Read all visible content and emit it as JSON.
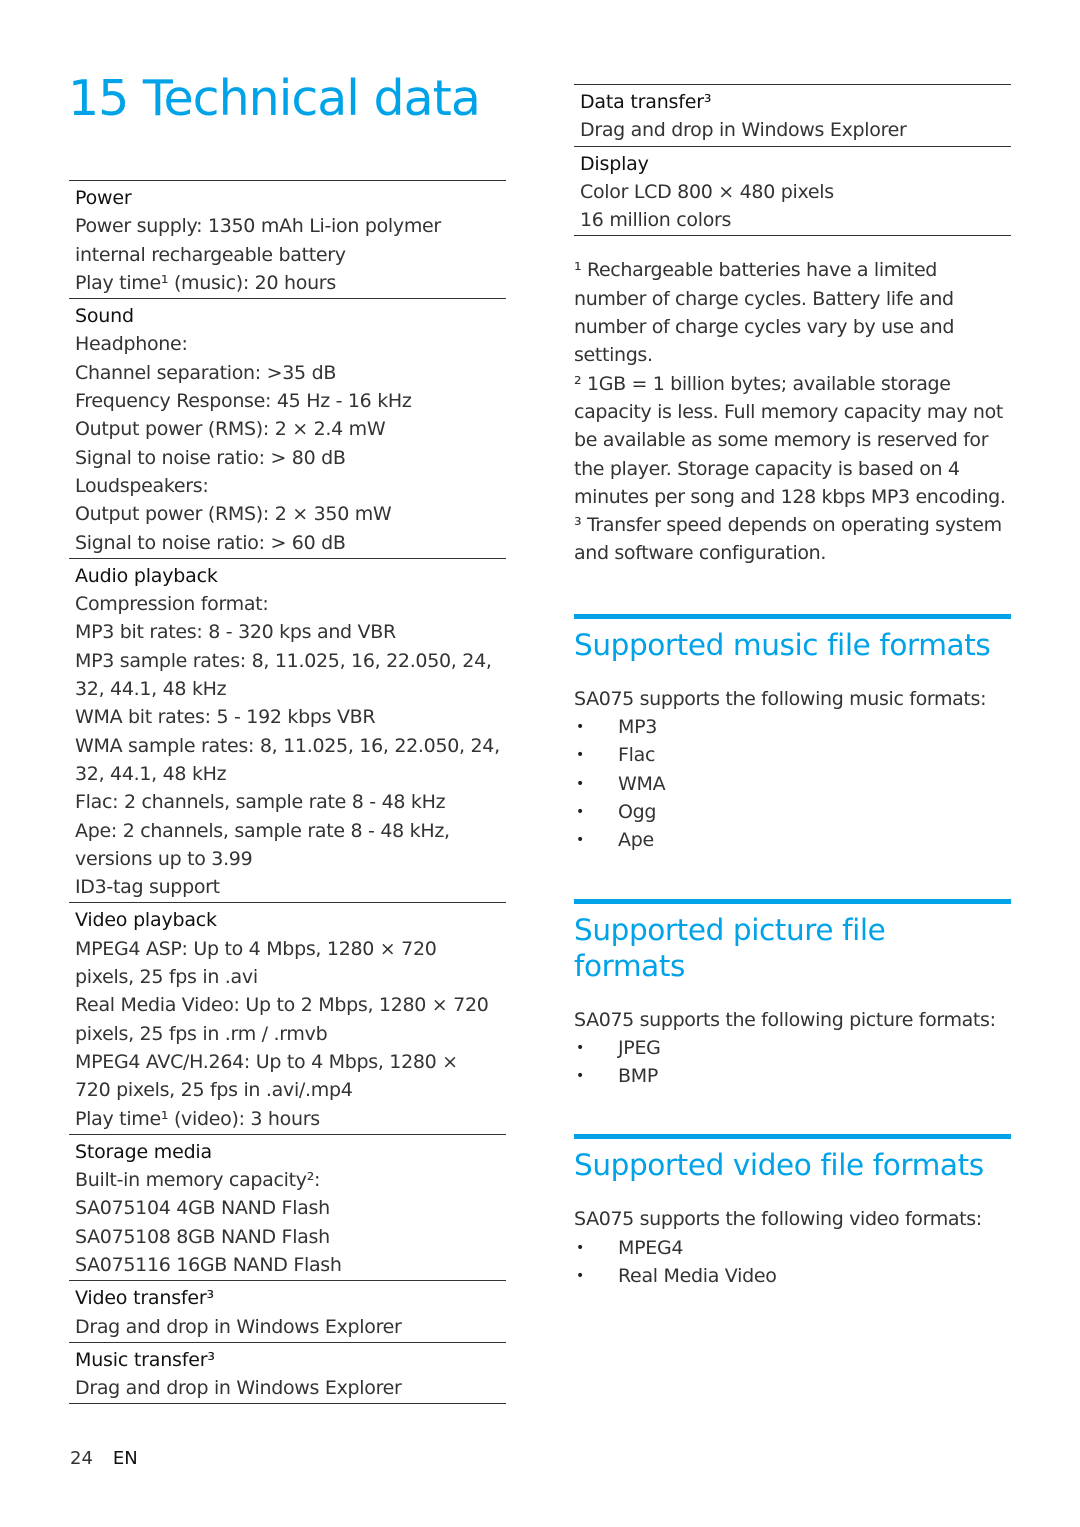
{
  "page": {
    "title": "15 Technical data",
    "accent_color": "#00a3e8"
  },
  "specs": [
    {
      "heading": "Power",
      "lines": [
        "Power supply: 1350 mAh Li-ion polymer",
        "internal rechargeable battery",
        "Play time¹ (music): 20 hours"
      ]
    },
    {
      "heading": "Sound",
      "lines": [
        "Headphone:",
        "Channel separation: >35 dB",
        "Frequency Response: 45 Hz - 16 kHz",
        "Output power (RMS): 2 × 2.4 mW",
        "Signal to noise ratio: > 80 dB",
        "Loudspeakers:",
        "Output power (RMS): 2 × 350 mW",
        "Signal to noise ratio: > 60 dB"
      ]
    },
    {
      "heading": "Audio playback",
      "lines": [
        "Compression format:",
        "MP3 bit rates: 8 - 320 kps and VBR",
        "MP3 sample rates: 8, 11.025, 16, 22.050, 24,",
        "32, 44.1, 48 kHz",
        "WMA bit rates: 5 - 192 kbps VBR",
        "WMA sample rates: 8, 11.025, 16, 22.050, 24,",
        "32, 44.1, 48 kHz",
        "Flac: 2 channels, sample rate 8 - 48 kHz",
        "Ape: 2 channels, sample rate 8 - 48 kHz,",
        "versions up to 3.99",
        "ID3-tag support"
      ]
    },
    {
      "heading": "Video playback",
      "lines": [
        "MPEG4 ASP: Up to 4 Mbps, 1280 × 720",
        "pixels, 25 fps in .avi",
        "Real Media Video: Up to 2 Mbps, 1280 × 720",
        "pixels, 25 fps in .rm / .rmvb",
        "MPEG4 AVC/H.264: Up to 4 Mbps, 1280 ×",
        "720 pixels, 25 fps in .avi/.mp4",
        "Play time¹ (video): 3 hours"
      ]
    },
    {
      "heading": "Storage media",
      "lines": [
        "Built-in memory capacity²:",
        "SA075104 4GB NAND Flash",
        "SA075108 8GB NAND Flash",
        "SA075116 16GB NAND Flash"
      ]
    },
    {
      "heading": "Video transfer³",
      "lines": [
        "Drag and drop in Windows Explorer"
      ]
    },
    {
      "heading": "Music transfer³",
      "lines": [
        "Drag and drop in Windows Explorer"
      ]
    }
  ],
  "specs_right": [
    {
      "heading": "Data transfer³",
      "lines": [
        "Drag and drop in Windows Explorer"
      ]
    },
    {
      "heading": "Display",
      "lines": [
        "Color LCD 800 × 480 pixels",
        "16 million colors"
      ]
    }
  ],
  "footnotes": [
    "¹ Rechargeable batteries have a limited number of charge cycles. Battery life and number of charge cycles vary by use and settings.",
    "² 1GB = 1 billion bytes; available storage capacity is less. Full memory capacity may not be available as some memory is reserved for the player. Storage capacity is based on 4 minutes per song and 128 kbps MP3 encoding.",
    "³ Transfer speed depends on operating system and software configuration."
  ],
  "sections": [
    {
      "title": "Supported music file formats",
      "intro": "SA075 supports the following music formats:",
      "items": [
        "MP3",
        "Flac",
        "WMA",
        "Ogg",
        "Ape"
      ]
    },
    {
      "title": "Supported picture file formats",
      "intro": "SA075 supports the following picture formats:",
      "items": [
        "JPEG",
        "BMP"
      ]
    },
    {
      "title": "Supported video file formats",
      "intro": "SA075 supports the following video formats:",
      "items": [
        "MPEG4",
        "Real Media Video"
      ]
    }
  ],
  "footer": {
    "page_number": "24",
    "language": "EN"
  }
}
